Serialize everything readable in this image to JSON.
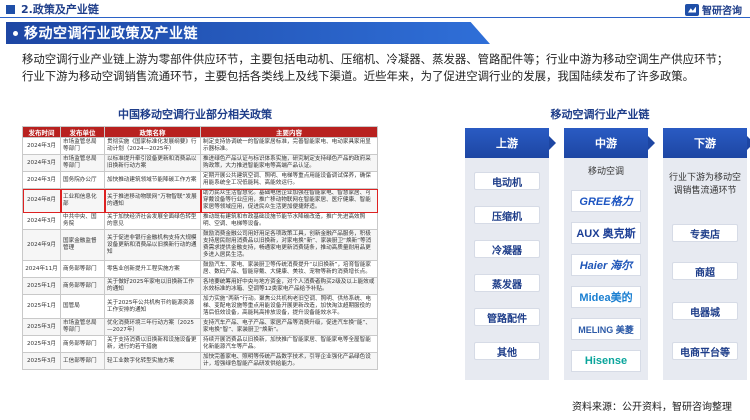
{
  "header": {
    "section": "2.政策及产业链",
    "logo": "智研咨询",
    "page_title": "移动空调行业政策及产业链"
  },
  "intro": "移动空调行业产业链上游为零部件供应环节，主要包括电动机、压缩机、冷凝器、蒸发器、管路配件等；行业中游为移动空调生产供应环节；行业下游为移动空调销售流通环节，主要包括各类线上及线下渠道。近些年来，为了促进空调行业的发展，我国陆续发布了许多政策。",
  "table": {
    "title": "中国移动空调行业部分相关政策",
    "columns": [
      "发布时间",
      "发布单位",
      "政策名称",
      "主要内容"
    ],
    "rows": [
      [
        "2024年3月",
        "市场监管总局等部门",
        "贯彻实施《国家标准化发展纲要》行动计划（2024—2025年）",
        "制定支持协调统一的智能家居标准，完善智能家电、电动家具家用显示器标准。"
      ],
      [
        "2024年3月",
        "市场监管总局等部门",
        "以标准提升牵引设备更新和消费品以旧换新行动方案",
        "推进绿色产品认证与标识体系实施，研究制定支持绿色产品的政府采购政策，大力推进智能家电等高端产品认证。"
      ],
      [
        "2024年3月",
        "国务院办公厅",
        "加快推动建筑领域节能降碳工作方案",
        "定期开展公共建筑空调、照明、电梯等重点用能设备调试保养，确保用能系统全工况低能耗、高能效运行。"
      ],
      [
        "2024年8月",
        "工业和信息化部",
        "关于推进移动物联网“万物智联”发展的通知",
        "助力民众生活智慧化。基础电信企业加强在智能家电、智慧家居、可穿戴设备等行业应用，推广移动物联网在智能家居、医疗健康、智能家居等领域应用，促进民众生活更加便捷舒适。"
      ],
      [
        "2024年3月",
        "中共中央、国务院",
        "关于加快经济社会发展全面绿色转型的意见",
        "推动既有建筑和市政基础设施节能节水降碳改造，推广先进高效照明、空调、电梯等设备。"
      ],
      [
        "2024年9月",
        "国家金融监督管理",
        "关于促进非银行金融机构支持大规模设备更新和消费品以旧换新行动的通知",
        "鼓励消费金融公司用好用足各项政策工具，创新金融产品服务，积极支持居民耐用消费品以旧换新，对家电换“新”、家装厨卫“焕新”等消费需求提供金融支持，畅通家电更新消费链条，推动高质量耐用品更多进入居民生活。"
      ],
      [
        "2024年11月",
        "商务部等部门",
        "零售业创新提升工程实施方案",
        "鼓励汽车、家电、家装厨卫等传统消费提升“以旧换新”，培育智能家居、数码产品、智能穿戴、大健康、美妆、宠物等新的消费增长点。"
      ],
      [
        "2025年1月",
        "商务部等部门",
        "关于做好2025年家电以旧换新工作的通知",
        "各地要统筹用好中央与地方资金，对个人消费者购买2级及以上能效或水效标准的冰箱、空调等12类家电产品给予补贴。"
      ],
      [
        "2025年1月",
        "国管局",
        "关于2025年公共机构节约能源资源工作安排的通知",
        "加力实施“两新”行动。聚焦公共机构老旧空调、照明、供热系统、电梯、变配电设施等重点用能设备开展更新改造，加快淘汰超期服役的落后低效设备，高能耗高排放设备，提升设备能效水平。"
      ],
      [
        "2025年3月",
        "市场监管总局等部门",
        "优化消费环境三年行动方案（2025—2027年）",
        "支持汽车产品、电子产品、家居产品等消费升级，促进汽车换“能”、家电换“智”、家装厨卫“焕新”。"
      ],
      [
        "2025年3月",
        "商务部等部门",
        "关于支持消费以旧换新和设施设备更新，进行的若干措施",
        "持续开展消费品以旧换新，加快推广智能家居、智能家电等全屋智能化新能源汽车等产品。"
      ],
      [
        "2025年3月",
        "工信部等部门",
        "轻工业数字化转型实施方案",
        "加快完善家电、照明等传统产品数字技术，引导企业强化产品绿色设计，增强绿色智能产品研发供给能力。"
      ]
    ]
  },
  "chain": {
    "title": "移动空调行业产业链",
    "upstream": {
      "label": "上游",
      "items": [
        "电动机",
        "压缩机",
        "冷凝器",
        "蒸发器",
        "管路配件",
        "其他"
      ]
    },
    "midstream": {
      "label": "中游",
      "subtitle": "移动空调",
      "brands": [
        "GREE格力",
        "AUX 奥克斯",
        "Haier 海尔",
        "Midea美的",
        "MELING 美菱",
        "Hisense"
      ]
    },
    "downstream": {
      "label": "下游",
      "text": "行业下游为移动空调销售流通环节",
      "items": [
        "专卖店",
        "商超",
        "电器城",
        "电商平台等"
      ]
    }
  },
  "source": "资料来源：公开资料，智研咨询整理",
  "colors": {
    "brand_blue": "#1d46a3",
    "table_header_red": "#b8211f"
  }
}
